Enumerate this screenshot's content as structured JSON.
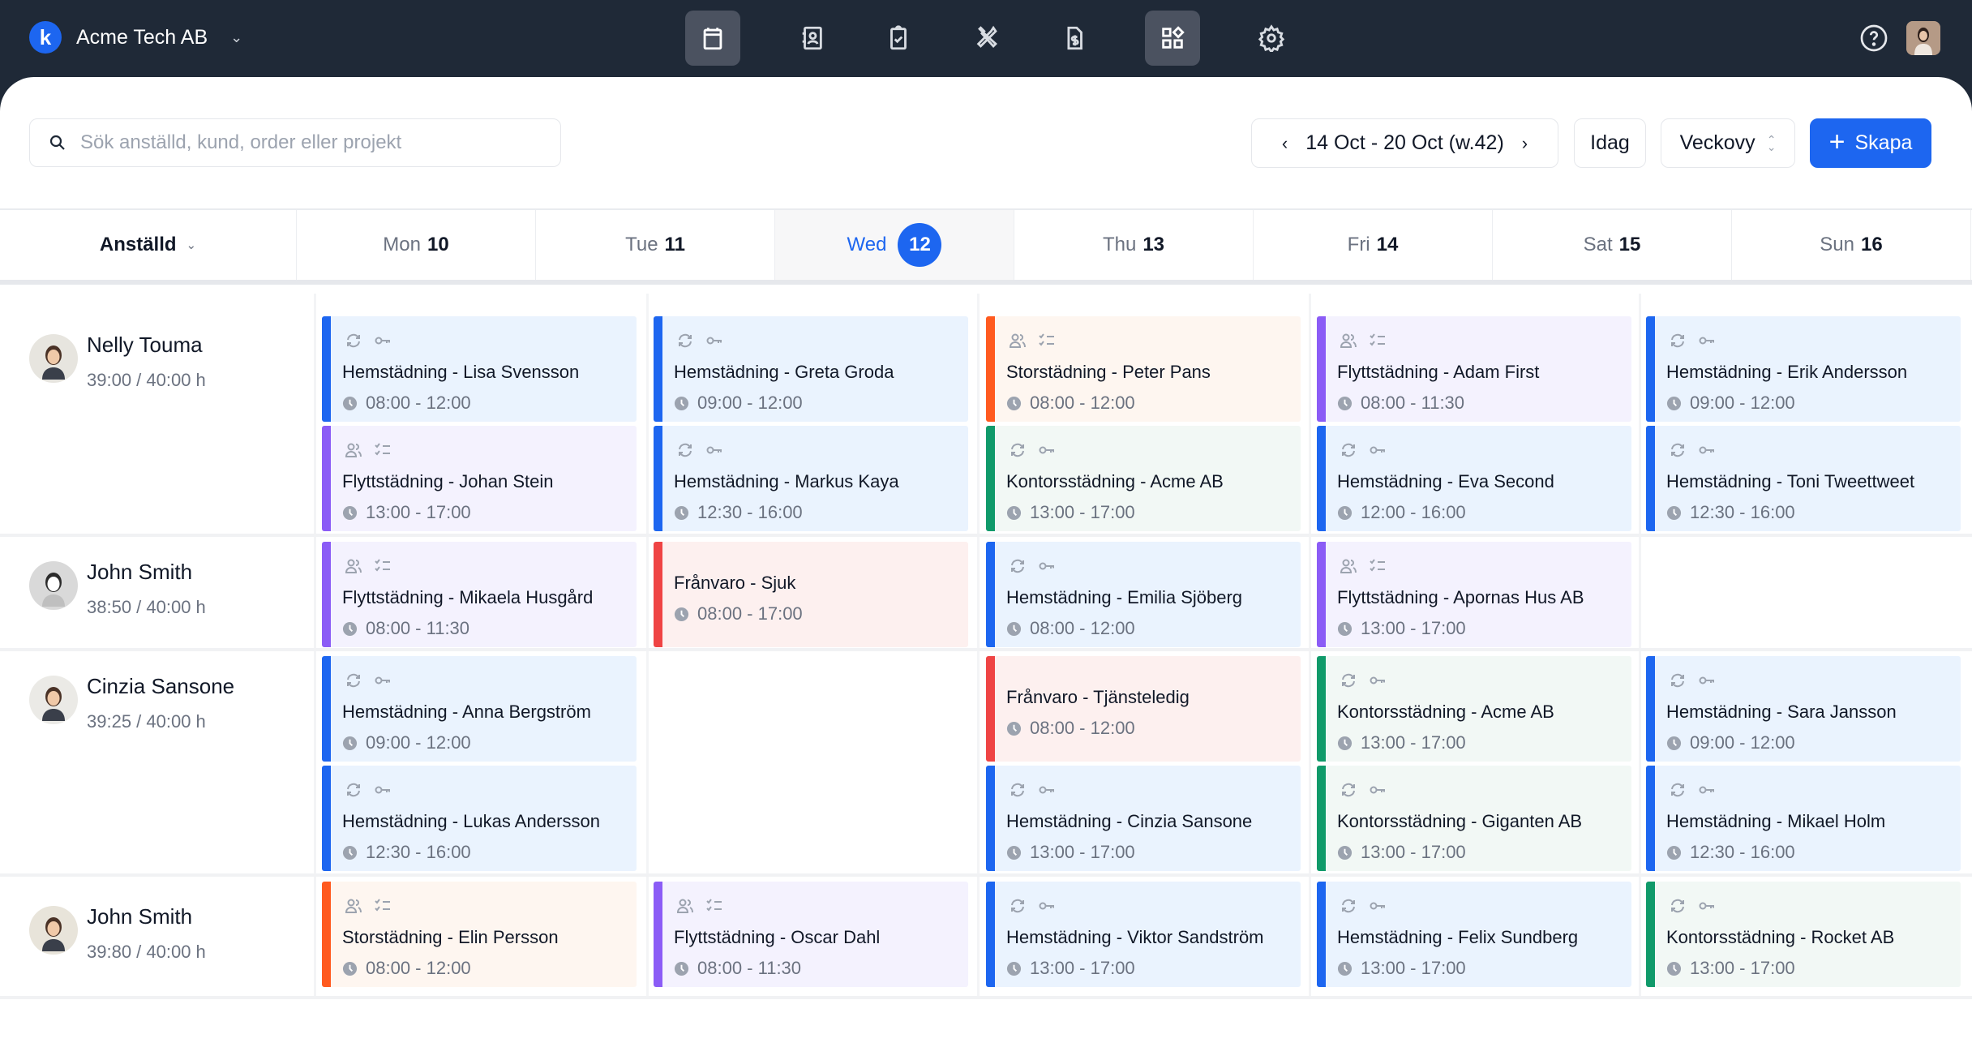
{
  "topbar": {
    "company": "Acme Tech AB",
    "logo_letter": "k",
    "nav": [
      {
        "icon": "calendar-icon",
        "label": "Schedule",
        "active": true
      },
      {
        "icon": "contacts-icon",
        "label": "Contacts",
        "active": false
      },
      {
        "icon": "clipboard-check-icon",
        "label": "Tasks",
        "active": false
      },
      {
        "icon": "tools-icon",
        "label": "Tools",
        "active": false
      },
      {
        "icon": "invoice-icon",
        "label": "Invoices",
        "active": false
      },
      {
        "icon": "apps-icon",
        "label": "Apps",
        "active": true
      },
      {
        "icon": "gear-icon",
        "label": "Settings",
        "active": false
      }
    ]
  },
  "toolbar": {
    "search_placeholder": "Sök anställd, kund, order eller projekt",
    "search_value": "",
    "date_range": "14 Oct - 20 Oct (w.42)",
    "today_label": "Idag",
    "view_label": "Veckovy",
    "create_label": "Skapa"
  },
  "calendar": {
    "employee_header": "Anställd",
    "days": [
      {
        "name": "Mon",
        "date": "10",
        "today": false
      },
      {
        "name": "Tue",
        "date": "11",
        "today": false
      },
      {
        "name": "Wed",
        "date": "12",
        "today": true
      },
      {
        "name": "Thu",
        "date": "13",
        "today": false
      },
      {
        "name": "Fri",
        "date": "14",
        "today": false
      },
      {
        "name": "Sat",
        "date": "15",
        "today": false
      },
      {
        "name": "Sun",
        "date": "16",
        "today": false
      }
    ],
    "colors": {
      "hemstadning": "#1d66f0",
      "flyttstadning": "#8b5cf6",
      "storstadning": "#ff5a1f",
      "kontorsstadning": "#109a6a",
      "franvaro": "#ef4444",
      "accent": "#1d66f0"
    },
    "employees": [
      {
        "name": "Nelly Touma",
        "hours": "39:00 / 40:00 h",
        "columns": [
          [
            {
              "title": "Hemstädning - Lisa Svensson",
              "time": "08:00 - 12:00",
              "type": "blue",
              "icons": [
                "recurring-icon",
                "key-icon"
              ]
            },
            {
              "title": "Flyttstädning - Johan Stein",
              "time": "13:00 - 17:00",
              "type": "purple",
              "icons": [
                "team-icon",
                "checklist-icon"
              ]
            }
          ],
          [
            {
              "title": "Hemstädning - Greta Groda",
              "time": "09:00 - 12:00",
              "type": "blue",
              "icons": [
                "recurring-icon",
                "key-icon"
              ]
            },
            {
              "title": "Hemstädning - Markus Kaya",
              "time": "12:30 - 16:00",
              "type": "blue",
              "icons": [
                "recurring-icon",
                "key-icon"
              ]
            }
          ],
          [
            {
              "title": "Storstädning - Peter Pans",
              "time": "08:00 - 12:00",
              "type": "orange",
              "icons": [
                "team-icon",
                "checklist-icon"
              ]
            },
            {
              "title": "Kontorsstädning - Acme AB",
              "time": "13:00 - 17:00",
              "type": "green",
              "icons": [
                "recurring-icon",
                "key-icon"
              ]
            }
          ],
          [
            {
              "title": "Flyttstädning - Adam First",
              "time": "08:00 - 11:30",
              "type": "purple",
              "icons": [
                "team-icon",
                "checklist-icon"
              ]
            },
            {
              "title": "Hemstädning - Eva Second",
              "time": "12:00 - 16:00",
              "type": "blue",
              "icons": [
                "recurring-icon",
                "key-icon"
              ]
            }
          ],
          [
            {
              "title": "Hemstädning - Erik Andersson",
              "time": "09:00 - 12:00",
              "type": "blue",
              "icons": [
                "recurring-icon",
                "key-icon"
              ]
            },
            {
              "title": "Hemstädning - Toni Tweettweet",
              "time": "12:30 - 16:00",
              "type": "blue",
              "icons": [
                "recurring-icon",
                "key-icon"
              ]
            }
          ]
        ]
      },
      {
        "name": "John Smith",
        "hours": "38:50 / 40:00 h",
        "columns": [
          [
            {
              "title": "Flyttstädning - Mikaela Husgård",
              "time": "08:00 - 11:30",
              "type": "purple",
              "icons": [
                "team-icon",
                "checklist-icon"
              ]
            }
          ],
          [
            {
              "title": "Frånvaro - Sjuk",
              "time": "08:00 - 17:00",
              "type": "red",
              "icons": []
            }
          ],
          [
            {
              "title": "Hemstädning - Emilia Sjöberg",
              "time": "08:00 - 12:00",
              "type": "blue",
              "icons": [
                "recurring-icon",
                "key-icon"
              ]
            }
          ],
          [
            {
              "title": "Flyttstädning - Apornas Hus AB",
              "time": "13:00 - 17:00",
              "type": "purple",
              "icons": [
                "team-icon",
                "checklist-icon"
              ]
            }
          ],
          []
        ]
      },
      {
        "name": "Cinzia Sansone",
        "hours": "39:25 / 40:00 h",
        "columns": [
          [
            {
              "title": "Hemstädning - Anna Bergström",
              "time": "09:00 - 12:00",
              "type": "blue",
              "icons": [
                "recurring-icon",
                "key-icon"
              ]
            },
            {
              "title": "Hemstädning - Lukas Andersson",
              "time": "12:30 - 16:00",
              "type": "blue",
              "icons": [
                "recurring-icon",
                "key-icon"
              ]
            }
          ],
          [],
          [
            {
              "title": "Frånvaro - Tjänsteledig",
              "time": "08:00 - 12:00",
              "type": "red",
              "icons": []
            },
            {
              "title": "Hemstädning - Cinzia Sansone",
              "time": "13:00 - 17:00",
              "type": "blue",
              "icons": [
                "recurring-icon",
                "key-icon"
              ]
            }
          ],
          [
            {
              "title": "Kontorsstädning - Acme AB",
              "time": "13:00 - 17:00",
              "type": "green",
              "icons": [
                "recurring-icon",
                "key-icon"
              ]
            },
            {
              "title": "Kontorsstädning - Giganten AB",
              "time": "13:00 - 17:00",
              "type": "green",
              "icons": [
                "recurring-icon",
                "key-icon"
              ]
            }
          ],
          [
            {
              "title": "Hemstädning - Sara Jansson",
              "time": "09:00 - 12:00",
              "type": "blue",
              "icons": [
                "recurring-icon",
                "key-icon"
              ]
            },
            {
              "title": "Hemstädning - Mikael Holm",
              "time": "12:30 - 16:00",
              "type": "blue",
              "icons": [
                "recurring-icon",
                "key-icon"
              ]
            }
          ]
        ]
      },
      {
        "name": "John Smith",
        "hours": "39:80 / 40:00 h",
        "columns": [
          [
            {
              "title": "Storstädning - Elin Persson",
              "time": "08:00 - 12:00",
              "type": "orange",
              "icons": [
                "team-icon",
                "checklist-icon"
              ]
            }
          ],
          [
            {
              "title": "Flyttstädning - Oscar Dahl",
              "time": "08:00 - 11:30",
              "type": "purple",
              "icons": [
                "team-icon",
                "checklist-icon"
              ]
            }
          ],
          [
            {
              "title": "Hemstädning - Viktor Sandström",
              "time": "13:00 - 17:00",
              "type": "blue",
              "icons": [
                "recurring-icon",
                "key-icon"
              ]
            }
          ],
          [
            {
              "title": "Hemstädning - Felix Sundberg",
              "time": "13:00 - 17:00",
              "type": "blue",
              "icons": [
                "recurring-icon",
                "key-icon"
              ]
            }
          ],
          [
            {
              "title": "Kontorsstädning - Rocket AB",
              "time": "13:00 - 17:00",
              "type": "green",
              "icons": [
                "recurring-icon",
                "key-icon"
              ]
            }
          ]
        ]
      }
    ]
  }
}
